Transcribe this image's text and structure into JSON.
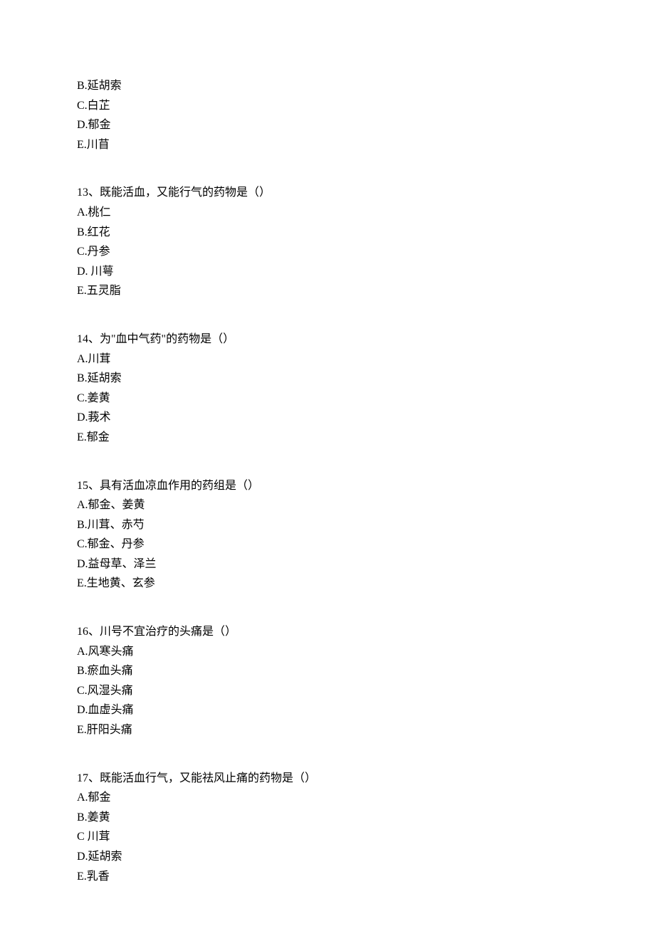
{
  "partial_options": {
    "b": "B.延胡索",
    "c": "C.白芷",
    "d": "D.郁金",
    "e": "E.川苜"
  },
  "questions": [
    {
      "number": "13、",
      "text": "既能活血，又能行气的药物是（）",
      "options": {
        "a": "A.桃仁",
        "b": "B.红花",
        "c": "C.丹参",
        "d": "D. 川萼",
        "e": "E.五灵脂"
      }
    },
    {
      "number": "14、",
      "text": "为\"血中气药\"的药物是（）",
      "options": {
        "a": "A.川茸",
        "b": "B.延胡索",
        "c": "C.姜黄",
        "d": "D.莪术",
        "e": "E.郁金"
      }
    },
    {
      "number": "15、",
      "text": "具有活血凉血作用的药组是（）",
      "options": {
        "a": "A.郁金、姜黄",
        "b": "B.川茸、赤芍",
        "c": "C.郁金、丹参",
        "d": "D.益母草、泽兰",
        "e": "E.生地黄、玄参"
      }
    },
    {
      "number": "16、",
      "text": "川号不宜治疗的头痛是（）",
      "options": {
        "a": "A.风寒头痛",
        "b": "B.瘀血头痛",
        "c": "C.风湿头痛",
        "d": "D.血虚头痛",
        "e": "E.肝阳头痛"
      }
    },
    {
      "number": "17、",
      "text": "既能活血行气，又能祛风止痛的药物是（）",
      "options": {
        "a": "A.郁金",
        "b": "B.姜黄",
        "c": "C 川茸",
        "d": "D.延胡索",
        "e": "E.乳香"
      }
    }
  ]
}
